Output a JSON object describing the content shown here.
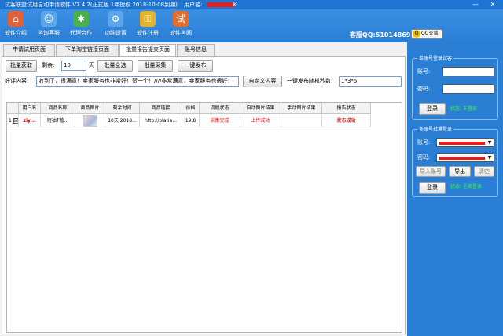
{
  "window": {
    "title": "试客联盟试用自动申请软件 V7.4.2(正式版 1年授权 2018-10-08到期)",
    "user_label": "用户名:",
    "user_value_suffix": "K",
    "controls": [
      "—",
      "✕"
    ]
  },
  "toolbar": {
    "items": [
      {
        "label": "软件介绍",
        "icon": "home-icon",
        "glyph": "⌂",
        "color": "#e0603a"
      },
      {
        "label": "咨询客服",
        "icon": "users-icon",
        "glyph": "☺",
        "color": "#5aa6e8"
      },
      {
        "label": "代理合作",
        "icon": "network-icon",
        "glyph": "✱",
        "color": "#4ab04a"
      },
      {
        "label": "功能设置",
        "icon": "settings-icon",
        "glyph": "⚙",
        "color": "#5aa6e8"
      },
      {
        "label": "软件注册",
        "icon": "key-icon",
        "glyph": "⚿",
        "color": "#e4b32a"
      },
      {
        "label": "软件官网",
        "icon": "site-icon",
        "glyph": "试",
        "color": "#e66c2c"
      }
    ],
    "qq_text": "客服QQ:510148694",
    "qq_button": "QQ交谈"
  },
  "tabs": [
    {
      "label": "申请试用页面",
      "active": false
    },
    {
      "label": "下单淘宝链接页面",
      "active": false
    },
    {
      "label": "批量报告提交页面",
      "active": true
    },
    {
      "label": "账号信息",
      "active": false
    }
  ],
  "controls": {
    "batch_fetch": "批量获取",
    "remaining_label": "剩余:",
    "remaining_value": "10",
    "day_unit": "天",
    "batch_select_all": "批量全选",
    "batch_collect": "批量采集",
    "one_click_publish": "一键发布",
    "review_label": "好评内容:",
    "review_value": "收到了，很满意！卖家服务也非常好！赞一个！////非常满意，卖家服务也很好！",
    "custom_content": "自定义内容",
    "random_seconds_label": "一键发布随机秒数:",
    "random_seconds_value": "1*3*5"
  },
  "table": {
    "headers": [
      "用户名",
      "商品名称",
      "商品图片",
      "剩余时间",
      "商品链接",
      "价格",
      "流程状态",
      "自动图片结果",
      "手动图片结果",
      "报告状态"
    ],
    "rows": [
      {
        "index": "1",
        "checked": "☑",
        "username": "ziy...",
        "product_name": "短袖T恤...",
        "remaining_time": "10天 2018...",
        "link": "http://platin...",
        "price": "19.8",
        "flow_status": "采集完成",
        "auto_image_result": "上传成功",
        "manual_image_result": "",
        "report_status": "发布成功"
      }
    ]
  },
  "single_login": {
    "title": "单账号登录试客",
    "account_label": "账号:",
    "password_label": "密码:",
    "login_button": "登录",
    "status": "状态: 未登录"
  },
  "multi_login": {
    "title": "多账号批量登录",
    "account_label": "账号:",
    "password_label": "密码:",
    "import_button": "导入账号",
    "export_button": "导出",
    "clear_button": "清空",
    "login_button": "登录",
    "status": "状态: 全部登录"
  },
  "colors": {
    "accent": "#2a7fd4",
    "status_red": "#e41d1d",
    "status_green": "#3dfc3d"
  }
}
